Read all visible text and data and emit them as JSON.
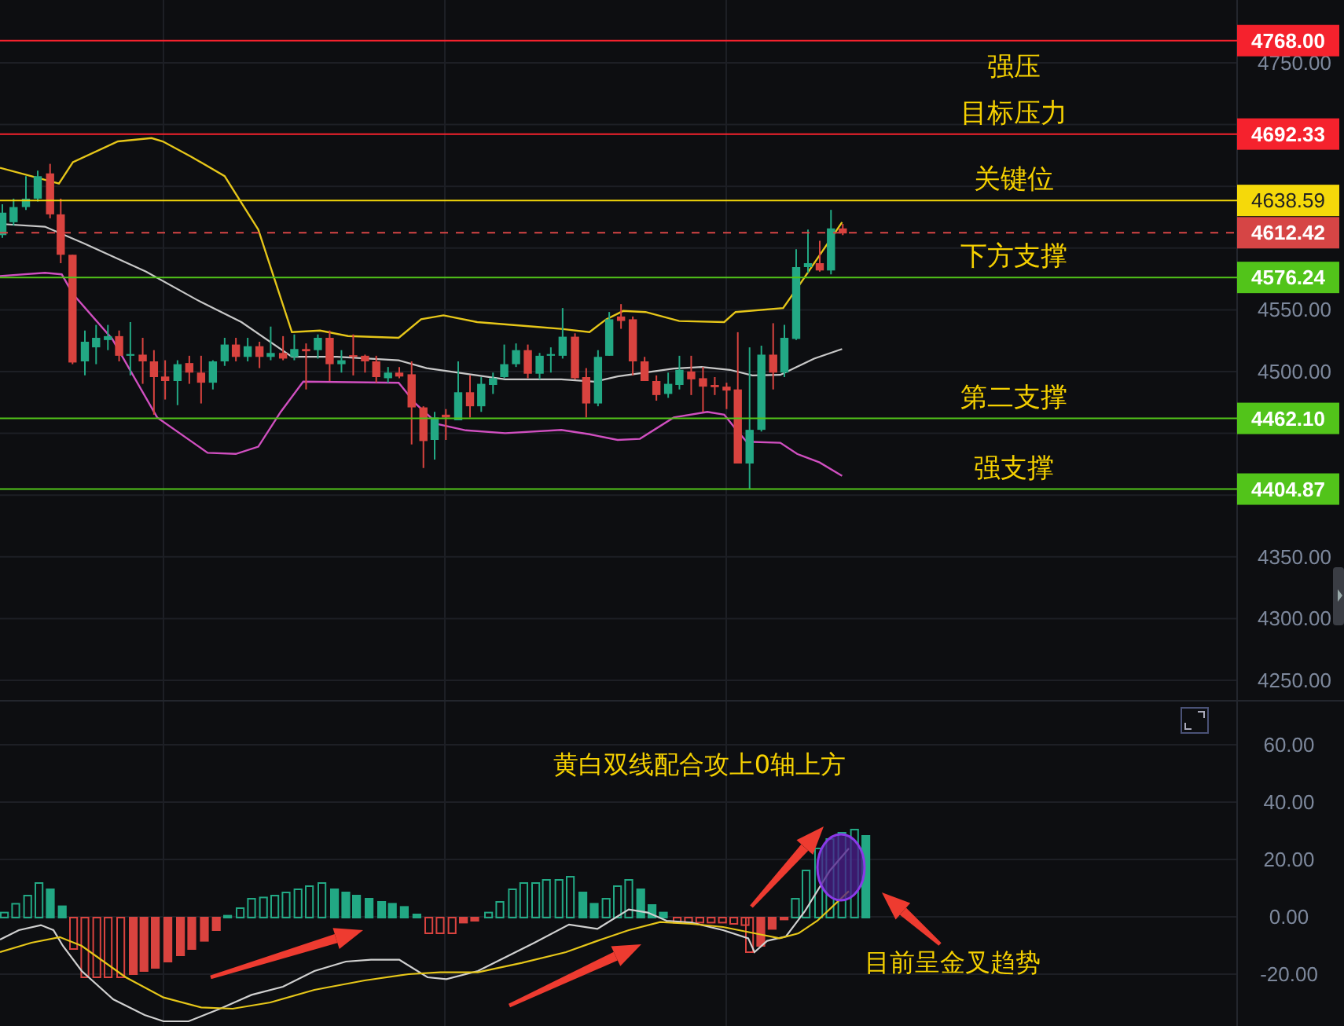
{
  "price_panel": {
    "y_axis_labels": [
      "4750.00",
      "4550.00",
      "4500.00",
      "4350.00",
      "4300.00",
      "4250.00"
    ],
    "levels": [
      {
        "price": "4768.00",
        "color": "#f5222d",
        "kind": "solid",
        "annotation": "强压"
      },
      {
        "price": "4692.33",
        "color": "#f5222d",
        "kind": "solid",
        "annotation": "目标压力"
      },
      {
        "price": "4638.59",
        "color": "#f5d90a",
        "kind": "solid",
        "annotation": "关键位"
      },
      {
        "price": "4612.42",
        "color": "#d64545",
        "kind": "dashed"
      },
      {
        "price": "4576.24",
        "color": "#52c41a",
        "kind": "solid",
        "annotation": "下方支撑"
      },
      {
        "price": "4462.10",
        "color": "#52c41a",
        "kind": "solid",
        "annotation": "第二支撑"
      },
      {
        "price": "4404.87",
        "color": "#52c41a",
        "kind": "solid",
        "annotation": "强支撑"
      }
    ]
  },
  "indicator_panel": {
    "y_axis_labels": [
      "60.00",
      "40.00",
      "20.00",
      "0.00",
      "-20.00"
    ],
    "note": "黄白双线配合攻上0轴上方",
    "callout": "目前呈金叉趋势"
  }
}
